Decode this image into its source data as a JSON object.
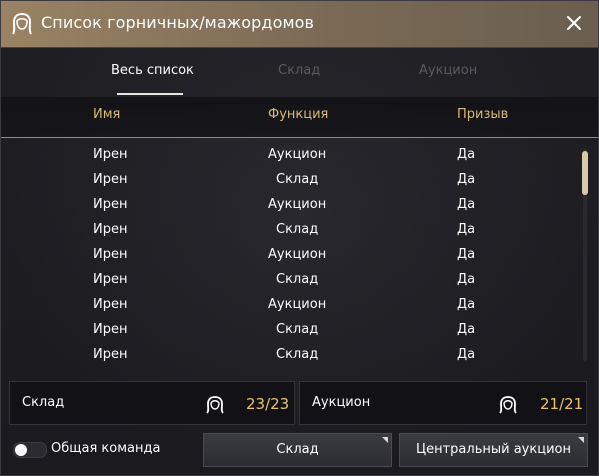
{
  "window": {
    "title": "Список горничных/мажордомов",
    "title_icon": "maid-icon",
    "close_icon": "close-icon"
  },
  "tabs": [
    {
      "label": "Весь список",
      "active": true
    },
    {
      "label": "Склад",
      "active": false
    },
    {
      "label": "Аукцион",
      "active": false
    }
  ],
  "table": {
    "headers": [
      "Имя",
      "Функция",
      "Призыв"
    ],
    "rows": [
      {
        "name": "Ирен",
        "function": "Аукцион",
        "summon": "Да"
      },
      {
        "name": "Ирен",
        "function": "Склад",
        "summon": "Да"
      },
      {
        "name": "Ирен",
        "function": "Аукцион",
        "summon": "Да"
      },
      {
        "name": "Ирен",
        "function": "Склад",
        "summon": "Да"
      },
      {
        "name": "Ирен",
        "function": "Аукцион",
        "summon": "Да"
      },
      {
        "name": "Ирен",
        "function": "Склад",
        "summon": "Да"
      },
      {
        "name": "Ирен",
        "function": "Аукцион",
        "summon": "Да"
      },
      {
        "name": "Ирен",
        "function": "Склад",
        "summon": "Да"
      },
      {
        "name": "Ирен",
        "function": "Склад",
        "summon": "Да"
      }
    ]
  },
  "summary": {
    "storage": {
      "label": "Склад",
      "count": "23/23",
      "icon": "maid-icon"
    },
    "auction": {
      "label": "Аукцион",
      "count": "21/21",
      "icon": "maid-icon"
    }
  },
  "footer": {
    "toggle_label": "Общая команда",
    "toggle_on": false,
    "storage_button": "Склад",
    "auction_button": "Центральный аукцион"
  },
  "colors": {
    "accent_gold": "#d9b878",
    "count_gold": "#e9c36c",
    "titlebar": "#9a8364"
  }
}
